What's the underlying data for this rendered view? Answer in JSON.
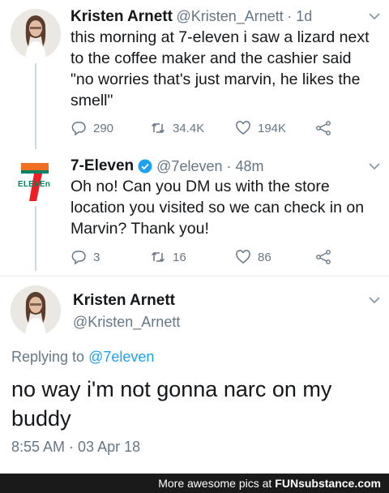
{
  "tweet1": {
    "name": "Kristen Arnett",
    "handle": "@Kristen_Arnett",
    "time": "· 1d",
    "text_lines": [
      "this morning at 7-eleven i saw a lizard next",
      "to the coffee maker and the cashier said",
      "\"no worries that's just marvin, he likes the",
      "smell\""
    ],
    "replies": "290",
    "retweets": "34.4K",
    "likes": "194K"
  },
  "tweet2": {
    "name": "7-Eleven",
    "handle": "@7eleven",
    "time": "· 48m",
    "logo_text": "ELEVEn",
    "text_lines": [
      "Oh no! Can you DM us with the store",
      "location you visited so we can check in on",
      "Marvin? Thank you!"
    ],
    "replies": "3",
    "retweets": "16",
    "likes": "86"
  },
  "tweet3": {
    "name": "Kristen Arnett",
    "handle": "@Kristen_Arnett",
    "replying_prefix": "Replying to",
    "replying_handle": "@7eleven",
    "text_lines": [
      "no way i'm not gonna narc on my",
      "buddy"
    ],
    "timestamp": "8:55 AM · 03 Apr 18"
  },
  "footer": {
    "text": "More awesome pics at",
    "brand": "FUNsubstance.com"
  },
  "colors": {
    "verified": "#1da1f2",
    "link": "#1da1f2",
    "muted": "#657786",
    "seven_orange": "#f26f21",
    "seven_green": "#008163",
    "seven_red": "#ee1c25"
  },
  "icons": [
    "reply-icon",
    "retweet-icon",
    "like-icon",
    "share-icon",
    "caret-down-icon",
    "verified-badge-icon"
  ]
}
